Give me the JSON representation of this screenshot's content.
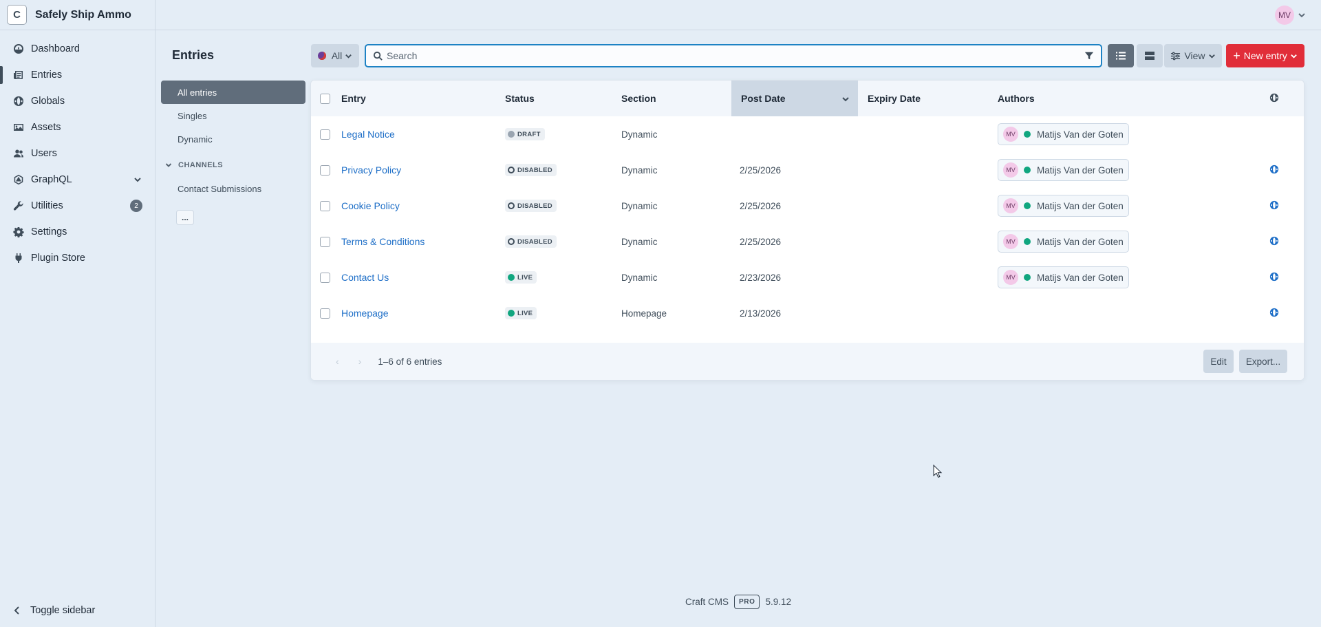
{
  "site": {
    "icon_letter": "C",
    "name": "Safely Ship Ammo"
  },
  "nav": {
    "items": [
      {
        "label": "Dashboard"
      },
      {
        "label": "Entries",
        "selected": true
      },
      {
        "label": "Globals"
      },
      {
        "label": "Assets"
      },
      {
        "label": "Users"
      },
      {
        "label": "GraphQL"
      },
      {
        "label": "Utilities",
        "badge": "2"
      },
      {
        "label": "Settings"
      },
      {
        "label": "Plugin Store"
      }
    ],
    "toggle_label": "Toggle sidebar"
  },
  "account": {
    "initials": "MV"
  },
  "page": {
    "title": "Entries"
  },
  "sources": {
    "items": [
      "All entries",
      "Singles",
      "Dynamic"
    ],
    "heading": "CHANNELS",
    "channel_items": [
      "Contact Submissions"
    ],
    "more_label": "..."
  },
  "toolbar": {
    "site_label": "All",
    "search_placeholder": "Search",
    "view_label": "View",
    "new_entry_label": "New entry"
  },
  "table": {
    "columns": [
      "Entry",
      "Status",
      "Section",
      "Post Date",
      "Expiry Date",
      "Authors"
    ],
    "rows": [
      {
        "title": "Legal Notice",
        "status": "DRAFT",
        "section": "Dynamic",
        "post_date": "",
        "expiry_date": "",
        "author_initials": "MV",
        "author": "Matijs Van der Goten",
        "has_globe": false
      },
      {
        "title": "Privacy Policy",
        "status": "DISABLED",
        "section": "Dynamic",
        "post_date": "2/25/2026",
        "expiry_date": "",
        "author_initials": "MV",
        "author": "Matijs Van der Goten",
        "has_globe": true
      },
      {
        "title": "Cookie Policy",
        "status": "DISABLED",
        "section": "Dynamic",
        "post_date": "2/25/2026",
        "expiry_date": "",
        "author_initials": "MV",
        "author": "Matijs Van der Goten",
        "has_globe": true
      },
      {
        "title": "Terms & Conditions",
        "status": "DISABLED",
        "section": "Dynamic",
        "post_date": "2/25/2026",
        "expiry_date": "",
        "author_initials": "MV",
        "author": "Matijs Van der Goten",
        "has_globe": true
      },
      {
        "title": "Contact Us",
        "status": "LIVE",
        "section": "Dynamic",
        "post_date": "2/23/2026",
        "expiry_date": "",
        "author_initials": "MV",
        "author": "Matijs Van der Goten",
        "has_globe": true
      },
      {
        "title": "Homepage",
        "status": "LIVE",
        "section": "Homepage",
        "post_date": "2/13/2026",
        "expiry_date": "",
        "author_initials": "",
        "author": "",
        "has_globe": true
      }
    ],
    "pagination": "1–6 of 6 entries",
    "edit_label": "Edit",
    "export_label": "Export..."
  },
  "footer": {
    "product": "Craft CMS",
    "edition": "PRO",
    "version": "5.9.12"
  },
  "colors": {
    "accent": "#1d82c4",
    "primary_button": "#e12d39",
    "live": "#10a67f",
    "link": "#1d6ec7"
  }
}
